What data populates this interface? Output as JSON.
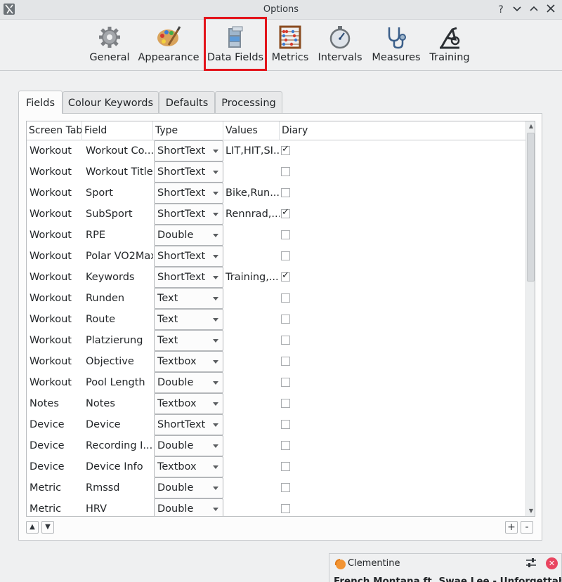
{
  "window": {
    "title": "Options",
    "help_label": "?",
    "dropdown_label": "⌄",
    "maximize_label": "^",
    "close_label": "✕"
  },
  "toolbar": {
    "items": [
      {
        "label": "General",
        "icon": "gear-icon"
      },
      {
        "label": "Appearance",
        "icon": "palette-icon"
      },
      {
        "label": "Data Fields",
        "icon": "filing-cabinet-icon"
      },
      {
        "label": "Metrics",
        "icon": "abacus-icon"
      },
      {
        "label": "Intervals",
        "icon": "stopwatch-icon"
      },
      {
        "label": "Measures",
        "icon": "stethoscope-icon"
      },
      {
        "label": "Training",
        "icon": "bike-trainer-icon"
      }
    ],
    "selected": "Data Fields"
  },
  "tabs": [
    "Fields",
    "Colour Keywords",
    "Defaults",
    "Processing"
  ],
  "table": {
    "headers": [
      "Screen Tab",
      "Field",
      "Type",
      "Values",
      "Diary"
    ],
    "rows": [
      {
        "tab": "Workout",
        "field": "Workout Co...",
        "type": "ShortText",
        "values": "LIT,HIT,SI...",
        "diary": "✓"
      },
      {
        "tab": "Workout",
        "field": "Workout Title",
        "type": "ShortText",
        "values": "",
        "diary": ""
      },
      {
        "tab": "Workout",
        "field": "Sport",
        "type": "ShortText",
        "values": "Bike,Run...",
        "diary": ""
      },
      {
        "tab": "Workout",
        "field": "SubSport",
        "type": "ShortText",
        "values": "Rennrad,...",
        "diary": "✓"
      },
      {
        "tab": "Workout",
        "field": "RPE",
        "type": "Double",
        "values": "",
        "diary": ""
      },
      {
        "tab": "Workout",
        "field": "Polar VO2Max",
        "type": "ShortText",
        "values": "",
        "diary": ""
      },
      {
        "tab": "Workout",
        "field": "Keywords",
        "type": "ShortText",
        "values": "Training,...",
        "diary": "✓"
      },
      {
        "tab": "Workout",
        "field": "Runden",
        "type": "Text",
        "values": "",
        "diary": ""
      },
      {
        "tab": "Workout",
        "field": "Route",
        "type": "Text",
        "values": "",
        "diary": ""
      },
      {
        "tab": "Workout",
        "field": "Platzierung",
        "type": "Text",
        "values": "",
        "diary": ""
      },
      {
        "tab": "Workout",
        "field": "Objective",
        "type": "Textbox",
        "values": "",
        "diary": ""
      },
      {
        "tab": "Workout",
        "field": "Pool Length",
        "type": "Double",
        "values": "",
        "diary": ""
      },
      {
        "tab": "Notes",
        "field": "Notes",
        "type": "Textbox",
        "values": "",
        "diary": ""
      },
      {
        "tab": "Device",
        "field": "Device",
        "type": "ShortText",
        "values": "",
        "diary": ""
      },
      {
        "tab": "Device",
        "field": "Recording I...",
        "type": "Double",
        "values": "",
        "diary": ""
      },
      {
        "tab": "Device",
        "field": "Device Info",
        "type": "Textbox",
        "values": "",
        "diary": ""
      },
      {
        "tab": "Metric",
        "field": "Rmssd",
        "type": "Double",
        "values": "",
        "diary": ""
      },
      {
        "tab": "Metric",
        "field": "HRV",
        "type": "Double",
        "values": "",
        "diary": ""
      }
    ]
  },
  "buttons": {
    "up": "▲",
    "down": "▼",
    "add": "+",
    "remove": "-"
  },
  "notification": {
    "app": "Clementine",
    "song": "French Montana ft. Swae Lee - Unforgettable",
    "close": "✕"
  },
  "colors": {
    "highlight": "#e3141b",
    "window_bg": "#eff0f1",
    "table_bg": "#ffffff"
  }
}
